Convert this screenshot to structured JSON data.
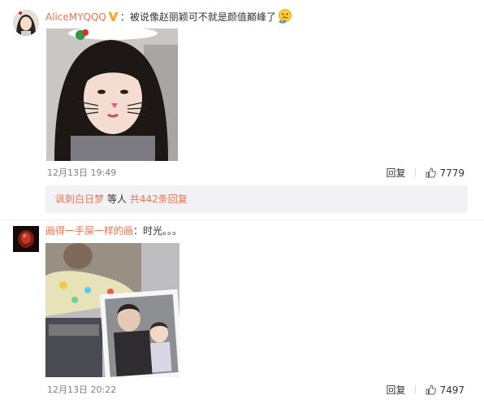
{
  "comments": [
    {
      "username": "AliceMYQQQ",
      "separator": "：",
      "text": "被说像赵丽颖可不就是颜值巅峰了",
      "has_vip_badge": true,
      "emoji_icon": "thinking-face-emoji",
      "time": "12月13日 19:49",
      "reply_label": "回复",
      "likes": "7779",
      "reply_summary": {
        "user": "讽刺白日梦",
        "middle_text": "等人",
        "more_text": "共442条回复"
      }
    },
    {
      "username": "画得一手屎一样的画",
      "separator": "：",
      "text": "时光。。。",
      "time": "12月13日 20:22",
      "reply_label": "回复",
      "likes": "7497"
    }
  ],
  "icons": {
    "like": "thumbs-up-icon",
    "vip": "v-badge-icon",
    "emoji": "thinking-face-emoji"
  },
  "colors": {
    "username": "#eb7350",
    "vip_badge": "#f6a623",
    "time": "#808080",
    "summary_bg": "#f2f2f5"
  }
}
